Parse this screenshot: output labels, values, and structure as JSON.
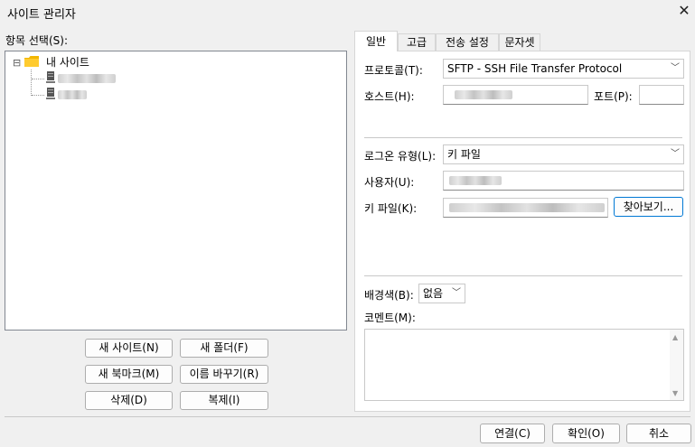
{
  "window": {
    "title": "사이트 관리자",
    "close_icon": "close-icon"
  },
  "left": {
    "header": "항목 선택(S):",
    "tree": {
      "root_label": "내 사이트",
      "toggle": "⊟",
      "children": [
        {
          "icon": "server-icon"
        },
        {
          "icon": "server-icon"
        }
      ]
    },
    "buttons": {
      "new_site": "새 사이트(N)",
      "new_folder": "새 폴더(F)",
      "new_bookmark": "새 북마크(M)",
      "rename": "이름 바꾸기(R)",
      "delete": "삭제(D)",
      "duplicate": "복제(I)"
    }
  },
  "tabs": [
    "일반",
    "고급",
    "전송 설정",
    "문자셋"
  ],
  "general": {
    "protocol_label": "프로토콜(T):",
    "protocol_value": "SFTP - SSH File Transfer Protocol",
    "host_label": "호스트(H):",
    "port_label": "포트(P):",
    "logon_label": "로그온 유형(L):",
    "logon_value": "키 파일",
    "user_label": "사용자(U):",
    "keyfile_label": "키 파일(K):",
    "browse_label": "찾아보기...",
    "bgcolor_label": "배경색(B):",
    "bgcolor_value": "없음",
    "comment_label": "코멘트(M):"
  },
  "footer": {
    "connect": "연결(C)",
    "ok": "확인(O)",
    "cancel": "취소"
  }
}
